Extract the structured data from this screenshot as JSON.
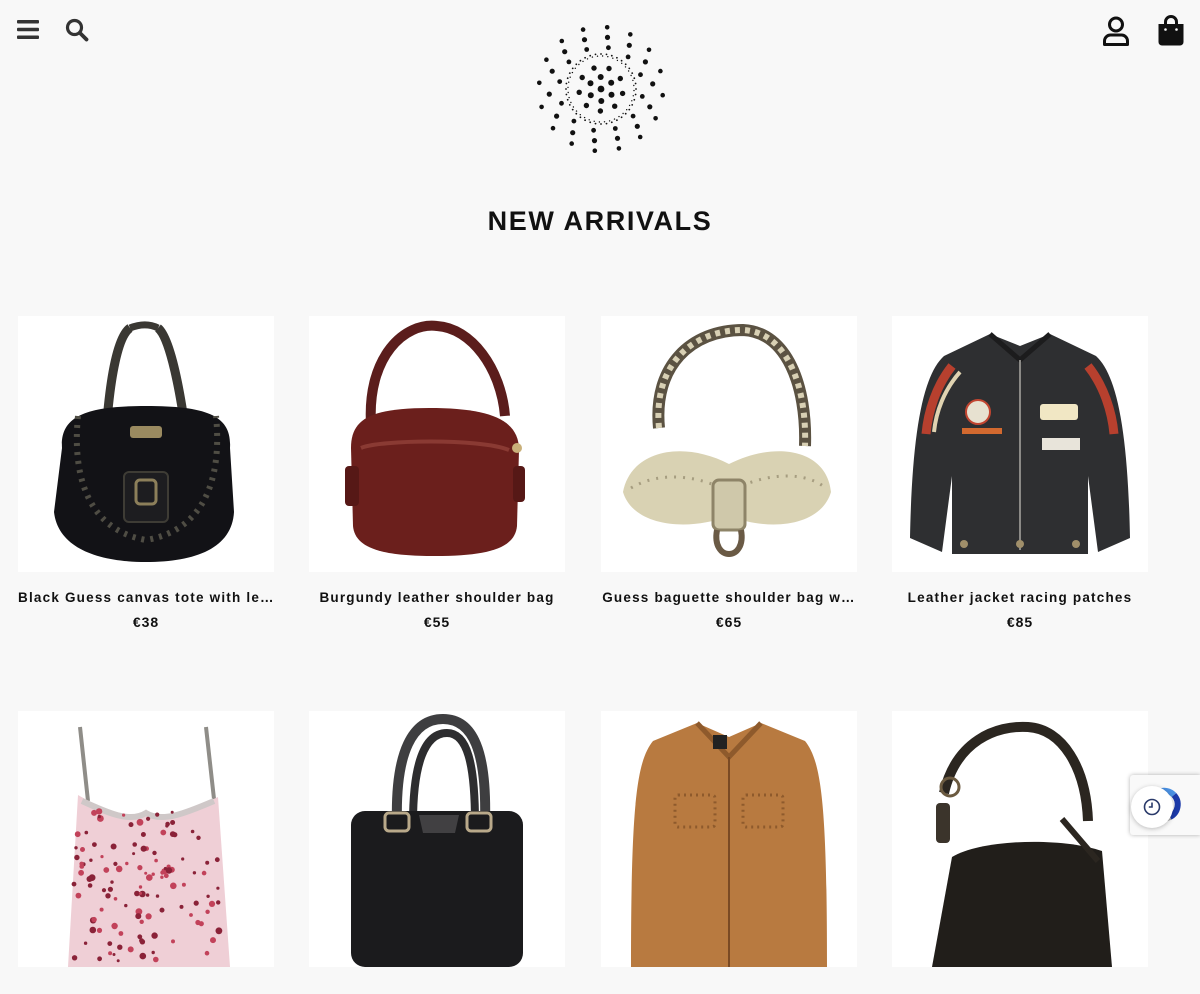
{
  "header": {
    "menu_icon": "hamburger-menu-icon",
    "search_icon": "search-icon",
    "account_icon": "user-icon",
    "cart_icon": "shopping-bag-icon",
    "logo_icon": "dotted-circle-logo"
  },
  "section": {
    "title": "NEW ARRIVALS"
  },
  "products": [
    {
      "name": "Black Guess canvas tote with le…",
      "price": "€38"
    },
    {
      "name": "Burgundy leather shoulder bag",
      "price": "€55"
    },
    {
      "name": "Guess baguette shoulder bag w…",
      "price": "€65"
    },
    {
      "name": "Leather jacket racing patches",
      "price": "€85"
    },
    {
      "name": "",
      "price": ""
    },
    {
      "name": "",
      "price": ""
    },
    {
      "name": "",
      "price": ""
    },
    {
      "name": "",
      "price": ""
    }
  ],
  "widgets": {
    "recaptcha_icon": "recaptcha-icon",
    "recent_icon": "clock-history-icon"
  },
  "colors": {
    "background": "#f8f8f8",
    "text": "#111111",
    "card_bg": "#ffffff"
  }
}
